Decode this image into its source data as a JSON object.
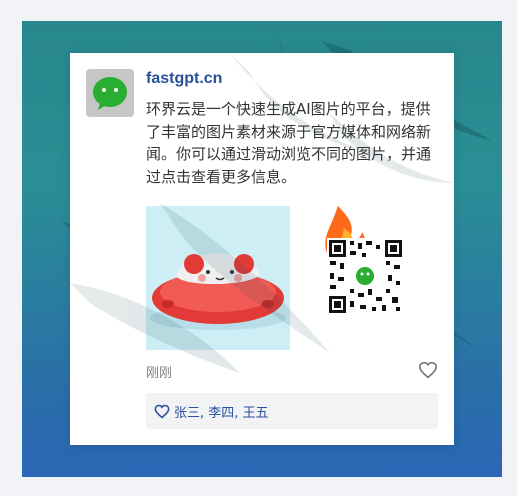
{
  "post": {
    "author": "fastgpt.cn",
    "message": "环界云是一个快速生成AI图片的平台，提供了丰富的图片素材来源于官方媒体和网络新闻。你可以通过滑动浏览不同的图片，并通过点击查看更多信息。",
    "time": "刚刚",
    "likes": "张三, 李四, 王五"
  },
  "icons": {
    "avatar": "wechat-icon",
    "like": "heart-outline-icon",
    "likes_prefix": "heart-outline-icon"
  },
  "colors": {
    "accent": "#2a4f9b",
    "background_top": "#27878c",
    "background_bottom": "#2c66b6",
    "wechat_green": "#2aae31"
  }
}
